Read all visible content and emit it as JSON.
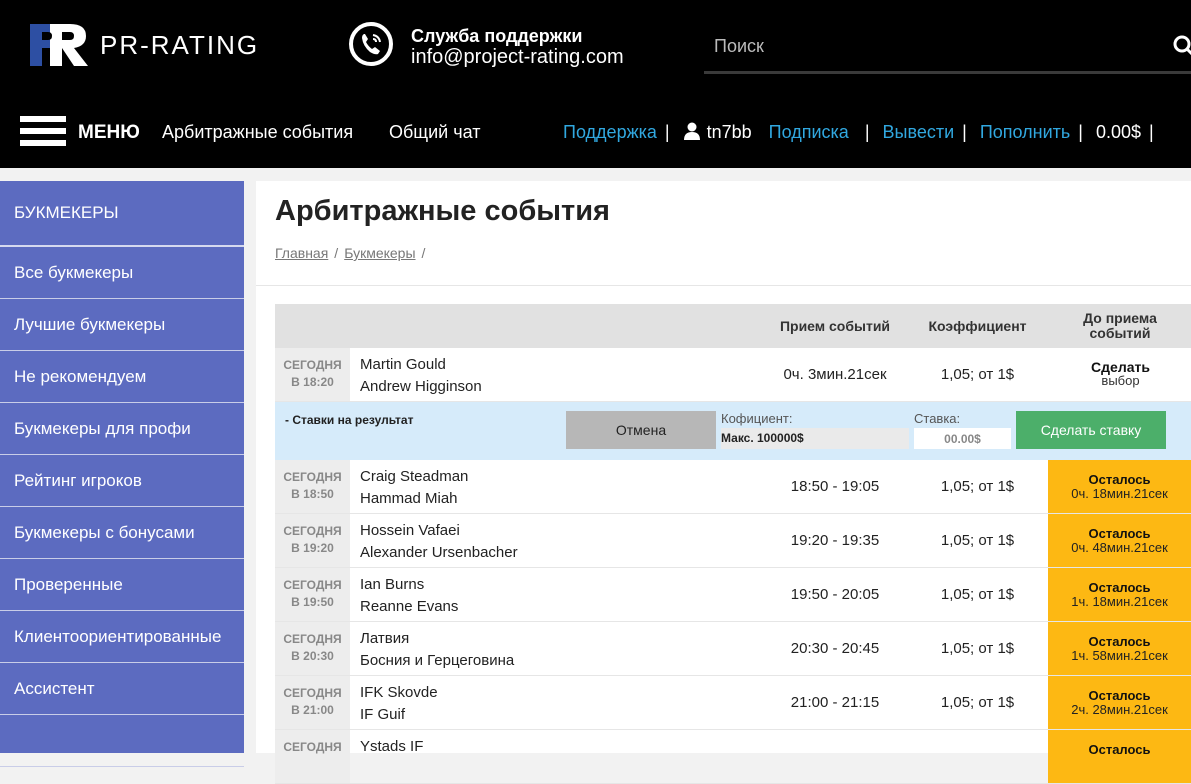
{
  "header": {
    "logo_text": "PR-RATING",
    "support_title": "Служба поддержки",
    "support_email": "info@project-rating.com",
    "search_placeholder": "Поиск"
  },
  "menubar": {
    "menu_label": "МЕНЮ",
    "links": [
      "Арбитражные события",
      "Общий чат"
    ],
    "support_link": "Поддержка",
    "username": "tn7bb",
    "subscription_link": "Подписка",
    "withdraw_link": "Вывести",
    "deposit_link": "Пополнить",
    "balance": "0.00$",
    "separator": "|"
  },
  "sidebar": {
    "heading": "БУКМЕКЕРЫ",
    "items": [
      "Все букмекеры",
      "Лучшие букмекеры",
      "Не рекомендуем",
      "Букмекеры для профи",
      "Рейтинг игроков",
      "Букмекеры с бонусами",
      "Проверенные",
      "Клиентоориентированные",
      "Ассистент",
      ""
    ]
  },
  "main": {
    "title": "Арбитражные события",
    "breadcrumb": [
      "Главная",
      "Букмекеры"
    ],
    "breadcrumb_sep": "/",
    "table": {
      "headers": {
        "time": "Прием событий",
        "coef": "Коэффициент",
        "until": "До приема событий"
      },
      "first_row": {
        "day": "СЕГОДНЯ",
        "time_of": "В 18:20",
        "team1": "Martin Gould",
        "team2": "Andrew Higginson",
        "countdown": "0ч. 3мин.21сек",
        "coef": "1,05; от 1$",
        "action_title": "Сделать",
        "action_sub": "выбор"
      },
      "bet_panel": {
        "label": "- Ставки на результат",
        "cancel": "Отмена",
        "coef_label": "Кофициент:",
        "coef_max": "Макс. 100000$",
        "stake_label": "Ставка:",
        "stake_placeholder": "00.00$",
        "submit": "Сделать ставку"
      },
      "rows": [
        {
          "day": "СЕГОДНЯ",
          "time_of": "В 18:50",
          "team1": "Craig Steadman",
          "team2": "Hammad Miah",
          "window": "18:50 - 19:05",
          "coef": "1,05; от 1$",
          "remain_title": "Осталось",
          "remain": "0ч. 18мин.21сек"
        },
        {
          "day": "СЕГОДНЯ",
          "time_of": "В 19:20",
          "team1": "Hossein Vafaei",
          "team2": "Alexander Ursenbacher",
          "window": "19:20 - 19:35",
          "coef": "1,05; от 1$",
          "remain_title": "Осталось",
          "remain": "0ч. 48мин.21сек"
        },
        {
          "day": "СЕГОДНЯ",
          "time_of": "В 19:50",
          "team1": "Ian Burns",
          "team2": "Reanne Evans",
          "window": "19:50 - 20:05",
          "coef": "1,05; от 1$",
          "remain_title": "Осталось",
          "remain": "1ч. 18мин.21сек"
        },
        {
          "day": "СЕГОДНЯ",
          "time_of": "В 20:30",
          "team1": "Латвия",
          "team2": "Босния и Герцеговина",
          "window": "20:30 - 20:45",
          "coef": "1,05; от 1$",
          "remain_title": "Осталось",
          "remain": "1ч. 58мин.21сек"
        },
        {
          "day": "СЕГОДНЯ",
          "time_of": "В 21:00",
          "team1": "IFK Skovde",
          "team2": "IF Guif",
          "window": "21:00 - 21:15",
          "coef": "1,05; от 1$",
          "remain_title": "Осталось",
          "remain": "2ч. 28мин.21сек"
        },
        {
          "day": "СЕГОДНЯ",
          "time_of": "",
          "team1": "Ystads IF",
          "team2": "",
          "window": "",
          "coef": "",
          "remain_title": "Осталось",
          "remain": ""
        }
      ]
    }
  },
  "colors": {
    "accent_link": "#31a8e0",
    "sidebar": "#5c6bc0",
    "remain": "#fdb813",
    "bet_button": "#4caf6a"
  }
}
